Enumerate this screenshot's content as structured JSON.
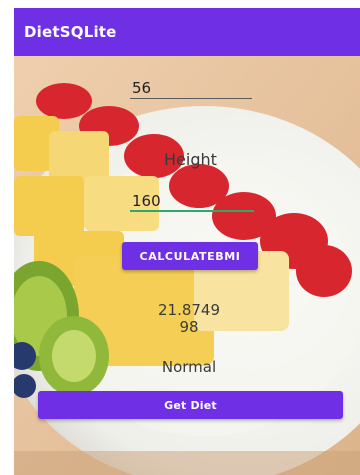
{
  "app": {
    "title": "DietSQLite"
  },
  "form": {
    "weight_value": "56",
    "height_label": "Height",
    "height_value": "160",
    "calculate_button": "CALCULATEBMI",
    "bmi_value_line1": "21.8749",
    "bmi_value_line2": "98",
    "category": "Normal",
    "diet_button": "Get Diet"
  },
  "colors": {
    "app_bar": "#6f2fe5",
    "button": "#6f2fe5",
    "focus_underline": "#2fa86b"
  }
}
